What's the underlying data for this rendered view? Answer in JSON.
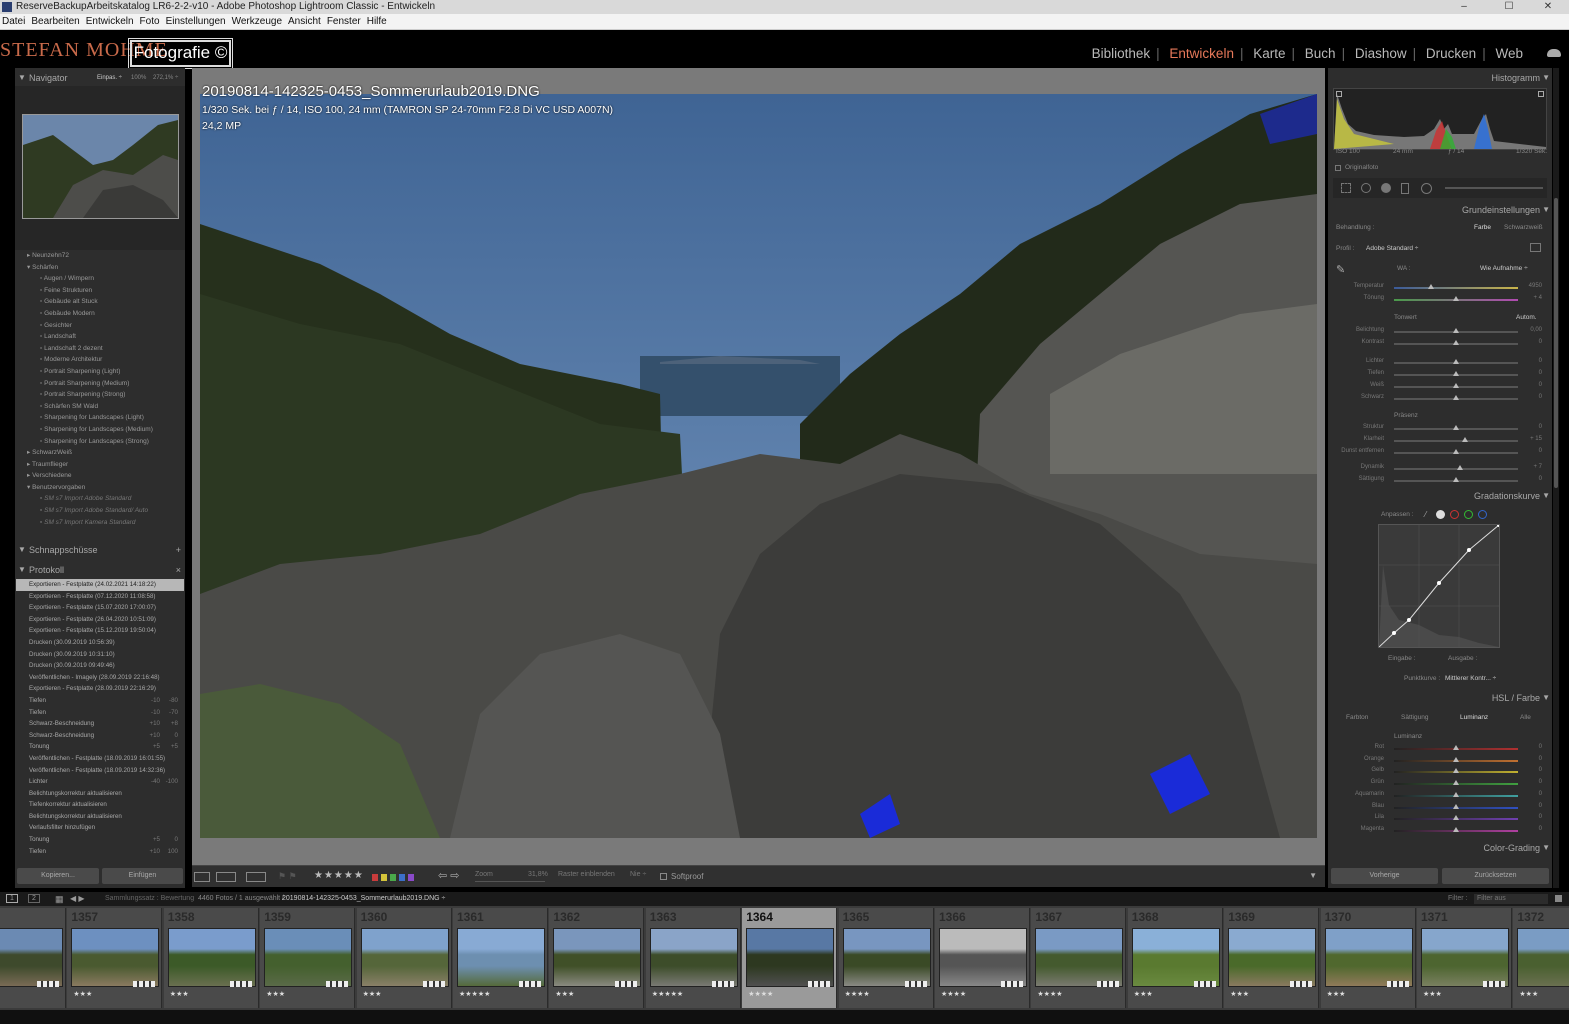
{
  "window": {
    "title": "ReserveBackupArbeitskatalog LR6-2-2-v10 - Adobe Photoshop Lightroom Classic - Entwickeln",
    "controls": [
      "–",
      "☐",
      "✕"
    ]
  },
  "menu": [
    "Datei",
    "Bearbeiten",
    "Entwickeln",
    "Foto",
    "Einstellungen",
    "Werkzeuge",
    "Ansicht",
    "Fenster",
    "Hilfe"
  ],
  "identity": {
    "logo_text": "STEFAN MOHME",
    "logo_box": "Fotografie ©"
  },
  "modules": {
    "items": [
      "Bibliothek",
      "Entwickeln",
      "Karte",
      "Buch",
      "Diashow",
      "Drucken",
      "Web"
    ],
    "active": "Entwickeln",
    "active_color": "#e7795a"
  },
  "left_panel": {
    "navigator": {
      "title": "Navigator",
      "fit": "Einpas. ÷",
      "zoom1": "100%",
      "zoom2": "272,1% ÷"
    },
    "presets": [
      {
        "label": "Neunzehn72",
        "level": 0,
        "open": false
      },
      {
        "label": "Schärfen",
        "level": 0,
        "open": true
      },
      {
        "label": "Augen / Wimpern",
        "level": 1
      },
      {
        "label": "Feine Strukturen",
        "level": 1
      },
      {
        "label": "Gebäude alt Stuck",
        "level": 1
      },
      {
        "label": "Gebäude Modern",
        "level": 1
      },
      {
        "label": "Gesichter",
        "level": 1
      },
      {
        "label": "Landschaft",
        "level": 1
      },
      {
        "label": "Landschaft 2 dezent",
        "level": 1
      },
      {
        "label": "Moderne Architektur",
        "level": 1
      },
      {
        "label": "Portrait Sharpening (Light)",
        "level": 1
      },
      {
        "label": "Portrait Sharpening (Medium)",
        "level": 1
      },
      {
        "label": "Portrait Sharpening (Strong)",
        "level": 1
      },
      {
        "label": "Schärfen SM Wald",
        "level": 1
      },
      {
        "label": "Sharpening for Landscapes (Light)",
        "level": 1
      },
      {
        "label": "Sharpening for Landscapes (Medium)",
        "level": 1
      },
      {
        "label": "Sharpening for Landscapes (Strong)",
        "level": 1
      },
      {
        "label": "SchwarzWeiß",
        "level": 0,
        "open": false
      },
      {
        "label": "Traumflieger",
        "level": 0,
        "open": false
      },
      {
        "label": "Verschiedene",
        "level": 0,
        "open": false
      },
      {
        "label": "",
        "level": 0
      },
      {
        "label": "Benutzervorgaben",
        "level": 0,
        "open": true
      },
      {
        "label": "SM s7 Import Adobe Standard",
        "level": 1
      },
      {
        "label": "SM s7 Import Adobe Standard/ Auto",
        "level": 1
      },
      {
        "label": "SM s7 Import Kamera Standard",
        "level": 1
      }
    ],
    "snapshots": {
      "title": "Schnappschüsse",
      "add": "+"
    },
    "history": {
      "title": "Protokoll",
      "close": "×",
      "items": [
        {
          "label": "Exportieren - Festplatte (24.02.2021 14:18:22)",
          "selected": true
        },
        {
          "label": "Exportieren - Festplatte (07.12.2020 11:08:58)"
        },
        {
          "label": "Exportieren - Festplatte (15.07.2020 17:00:07)"
        },
        {
          "label": "Exportieren - Festplatte (26.04.2020 10:51:09)"
        },
        {
          "label": "Exportieren - Festplatte (15.12.2019 19:50:04)"
        },
        {
          "label": "Drucken (30.09.2019 10:56:39)"
        },
        {
          "label": "Drucken (30.09.2019 10:31:10)"
        },
        {
          "label": "Drucken (30.09.2019 09:49:46)"
        },
        {
          "label": "Veröffentlichen - Imagely (28.09.2019 22:16:48)"
        },
        {
          "label": "Exportieren - Festplatte (28.09.2019 22:16:29)"
        },
        {
          "label": "Tiefen",
          "a": "-10",
          "b": "-80"
        },
        {
          "label": "Tiefen",
          "a": "-10",
          "b": "-70"
        },
        {
          "label": "Schwarz-Beschneidung",
          "a": "+10",
          "b": "+8"
        },
        {
          "label": "Schwarz-Beschneidung",
          "a": "+10",
          "b": "0"
        },
        {
          "label": "Tonung",
          "a": "+5",
          "b": "+5"
        },
        {
          "label": "Veröffentlichen - Festplatte (18.09.2019 16:01:55)"
        },
        {
          "label": "Veröffentlichen - Festplatte (18.09.2019 14:32:36)"
        },
        {
          "label": "Lichter",
          "a": "-40",
          "b": "-100"
        },
        {
          "label": "Belichtungskorrektur aktualisieren"
        },
        {
          "label": "Tiefenkorrektur aktualisieren"
        },
        {
          "label": "Belichtungskorrektur aktualisieren"
        },
        {
          "label": "Verlaufsfilter hinzufügen"
        },
        {
          "label": "Tonung",
          "a": "+5",
          "b": "0"
        },
        {
          "label": "Tiefen",
          "a": "+10",
          "b": "100"
        }
      ]
    },
    "buttons": {
      "copy": "Kopieren...",
      "paste": "Einfügen"
    }
  },
  "photo": {
    "filename": "20190814-142325-0453_Sommerurlaub2019.DNG",
    "exif": "1/320 Sek. bei ƒ / 14, ISO 100, 24 mm (TAMRON SP 24-70mm F2.8 Di VC USD A007N)",
    "megapixels": "24,2 MP"
  },
  "toolbar": {
    "stars": "★★★★★",
    "color_labels": [
      "#c83c3c",
      "#d4c43a",
      "#4aa84a",
      "#3c6fc8",
      "#8a4ac8"
    ],
    "zoom_label": "Zoom",
    "zoom_value": "31,8%",
    "grid_label": "Raster einblenden",
    "grid_value": "Nie ÷",
    "softproof": "Softproof"
  },
  "right_panel": {
    "histogram": {
      "title": "Histogramm",
      "iso": "ISO 100",
      "focal": "24 mm",
      "aperture": "ƒ / 14",
      "shutter": "1/320 Sek.",
      "original": "Originalfoto"
    },
    "basic": {
      "title": "Grundeinstellungen",
      "treatment_label": "Behandlung :",
      "treatment_color": "Farbe",
      "treatment_bw": "Schwarzweiß",
      "profile_label": "Profil :",
      "profile_value": "Adobe Standard ÷",
      "wb_label": "WA :",
      "wb_value": "Wie Aufnahme ÷",
      "tone_label": "Tonwert",
      "tone_auto": "Autom.",
      "presence_label": "Präsenz",
      "sliders": [
        {
          "label": "Temperatur",
          "value": "4950",
          "pos": 0.3
        },
        {
          "label": "Tönung",
          "value": "+ 4",
          "pos": 0.5
        },
        {
          "label": "Belichtung",
          "value": "0,00",
          "pos": 0.5
        },
        {
          "label": "Kontrast",
          "value": "0",
          "pos": 0.5
        },
        {
          "label": "Lichter",
          "value": "0",
          "pos": 0.5
        },
        {
          "label": "Tiefen",
          "value": "0",
          "pos": 0.5
        },
        {
          "label": "Weiß",
          "value": "0",
          "pos": 0.5
        },
        {
          "label": "Schwarz",
          "value": "0",
          "pos": 0.5
        },
        {
          "label": "Struktur",
          "value": "0",
          "pos": 0.5
        },
        {
          "label": "Klarheit",
          "value": "+ 15",
          "pos": 0.57
        },
        {
          "label": "Dunst entfernen",
          "value": "0",
          "pos": 0.5
        },
        {
          "label": "Dynamik",
          "value": "+ 7",
          "pos": 0.53
        },
        {
          "label": "Sättigung",
          "value": "0",
          "pos": 0.5
        }
      ]
    },
    "tone_curve": {
      "title": "Gradationskurve",
      "adjust_label": "Anpassen :",
      "input_label": "Eingabe :",
      "output_label": "Ausgabe :",
      "point_curve_label": "Punktkurve :",
      "point_curve_value": "Mittlerer Kontr... ÷"
    },
    "hsl": {
      "title": "HSL / Farbe",
      "tabs": [
        "Farbton",
        "Sättigung",
        "Luminanz",
        "Alle"
      ],
      "active_tab": "Luminanz",
      "group_label": "Luminanz",
      "sliders": [
        {
          "label": "Rot",
          "value": "0"
        },
        {
          "label": "Orange",
          "value": "0"
        },
        {
          "label": "Gelb",
          "value": "0"
        },
        {
          "label": "Grün",
          "value": "0"
        },
        {
          "label": "Aquamarin",
          "value": "0"
        },
        {
          "label": "Blau",
          "value": "0"
        },
        {
          "label": "Lila",
          "value": "0"
        },
        {
          "label": "Magenta",
          "value": "0"
        }
      ]
    },
    "color_grading": {
      "title": "Color-Grading"
    },
    "buttons": {
      "previous": "Vorherige",
      "reset": "Zurücksetzen"
    }
  },
  "filmstrip_bar": {
    "pages": [
      "1",
      "2"
    ],
    "source": "Sammlungssatz : Bewertung",
    "count": "4460 Fotos / 1 ausgewählt /",
    "file": "20190814-142325-0453_Sommerurlaub2019.DNG ÷",
    "filter_label": "Filter :",
    "filter_value": "Filter aus"
  },
  "filmstrip": {
    "numbers": [
      "",
      "1357",
      "1358",
      "1359",
      "1360",
      "1361",
      "1362",
      "1363",
      "1364",
      "1365",
      "1366",
      "1367",
      "1368",
      "1369",
      "1370",
      "1371",
      "1372"
    ],
    "ratings": [
      "",
      "★★★",
      "★★★",
      "★★★",
      "★★★",
      "★★★★★",
      "★★★",
      "★★★★★",
      "★★★★",
      "★★★★",
      "★★★★",
      "★★★★",
      "★★★",
      "★★★",
      "★★★",
      "★★★",
      "★★★"
    ],
    "selected_index": 8
  }
}
